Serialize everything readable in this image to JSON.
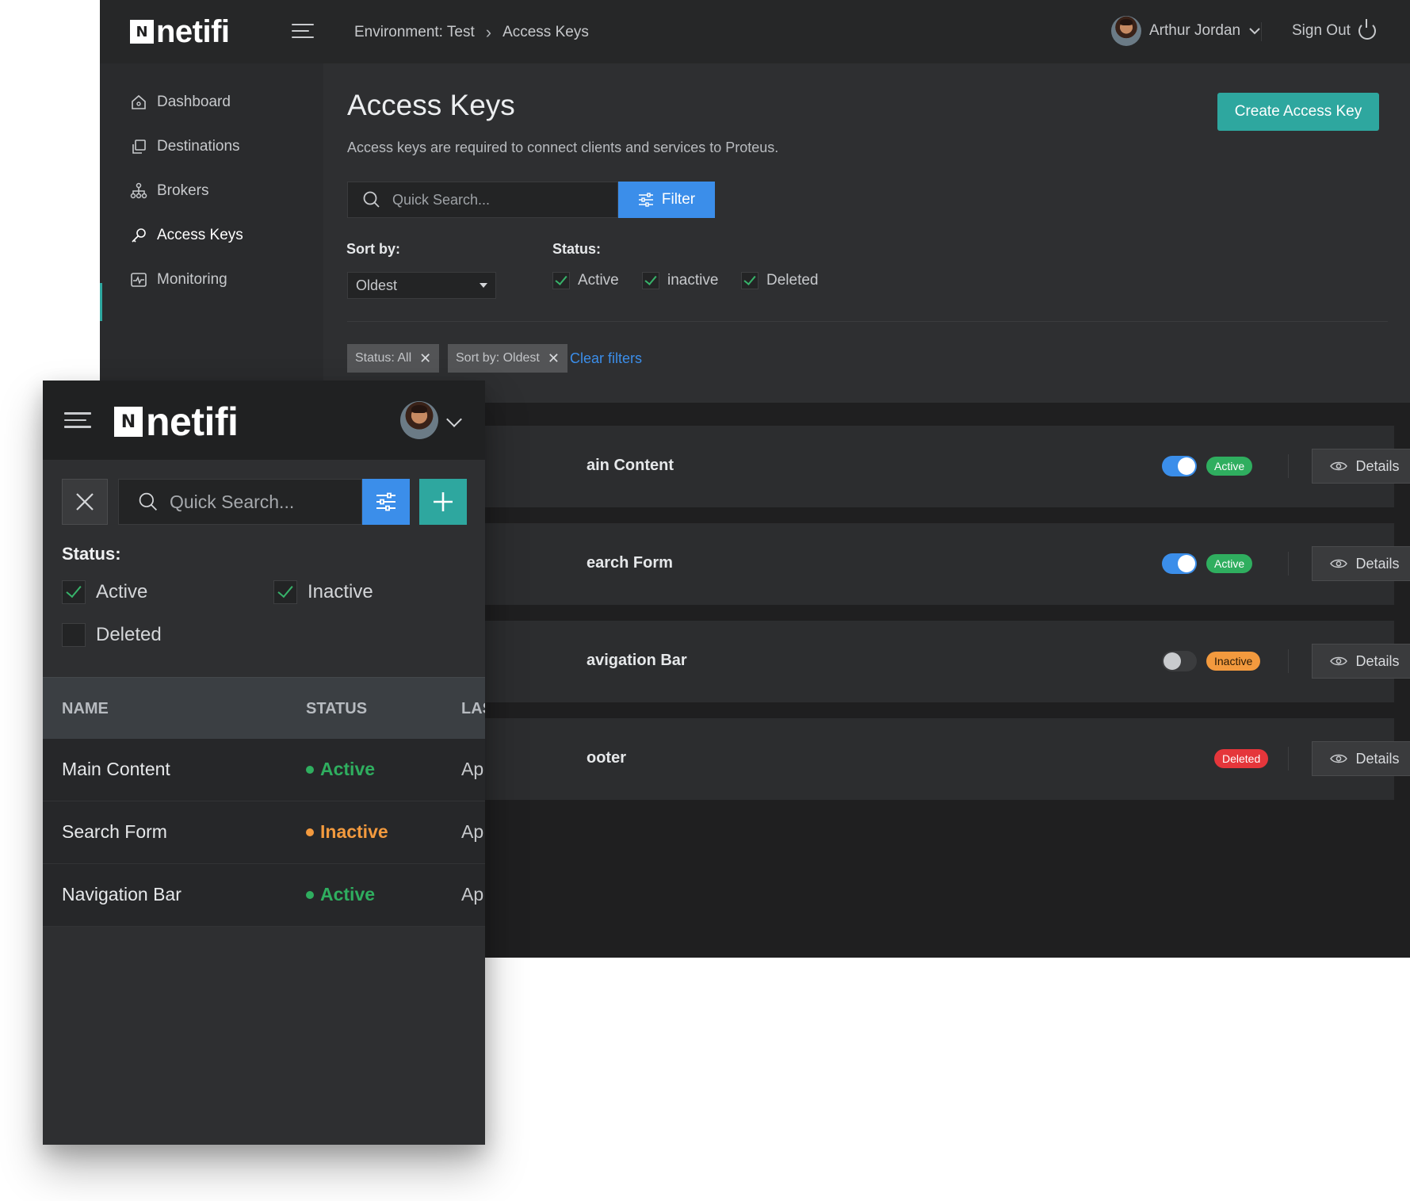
{
  "brand": {
    "logo_mark": "N",
    "logo_word": "netifi"
  },
  "desktop": {
    "breadcrumb": [
      "Environment: Test",
      "Access Keys"
    ],
    "user": {
      "name": "Arthur Jordan"
    },
    "sign_out_label": "Sign Out",
    "sidebar": {
      "items": [
        {
          "label": "Dashboard",
          "icon": "home-icon"
        },
        {
          "label": "Destinations",
          "icon": "copy-icon"
        },
        {
          "label": "Brokers",
          "icon": "network-icon"
        },
        {
          "label": "Access Keys",
          "icon": "key-icon",
          "active": true
        },
        {
          "label": "Monitoring",
          "icon": "pulse-icon"
        }
      ]
    },
    "page": {
      "title": "Access Keys",
      "description": "Access keys are required to connect clients and services to Proteus.",
      "create_button": "Create Access Key",
      "search_placeholder": "Quick Search...",
      "filter_button": "Filter",
      "sort_label": "Sort by:",
      "sort_value": "Oldest",
      "status_label": "Status:",
      "status_options": [
        {
          "label": "Active",
          "checked": true
        },
        {
          "label": "inactive",
          "checked": true
        },
        {
          "label": "Deleted",
          "checked": true
        }
      ],
      "chips": [
        "Status: All",
        "Sort by: Oldest"
      ],
      "clear_filters": "Clear filters"
    },
    "rows": [
      {
        "name": "ain Content",
        "status": "Active",
        "toggle_on": true,
        "action_icon": "trash-icon"
      },
      {
        "name": "earch Form",
        "status": "Active",
        "toggle_on": true,
        "action_icon": "trash-icon"
      },
      {
        "name": "avigation Bar",
        "status": "Inactive",
        "toggle_on": false,
        "action_icon": "trash-icon"
      },
      {
        "name": "ooter",
        "status": "Deleted",
        "toggle_on": null,
        "action_icon": "restore-icon"
      }
    ],
    "details_label": "Details"
  },
  "mobile": {
    "search_placeholder": "Quick Search...",
    "status_label": "Status:",
    "status_options": [
      {
        "label": "Active",
        "checked": true
      },
      {
        "label": "Inactive",
        "checked": true
      },
      {
        "label": "Deleted",
        "checked": false
      }
    ],
    "columns": [
      "NAME",
      "STATUS",
      "LAS"
    ],
    "rows": [
      {
        "name": "Main Content",
        "status": "Active",
        "last": "Ap"
      },
      {
        "name": "Search Form",
        "status": "Inactive",
        "last": "Ap"
      },
      {
        "name": "Navigation Bar",
        "status": "Active",
        "last": "Ap"
      }
    ]
  },
  "colors": {
    "accent_teal": "#2ea79f",
    "accent_blue": "#3b8eea",
    "status_active": "#2fae5f",
    "status_inactive": "#f39a3e",
    "status_deleted": "#e5363b"
  }
}
